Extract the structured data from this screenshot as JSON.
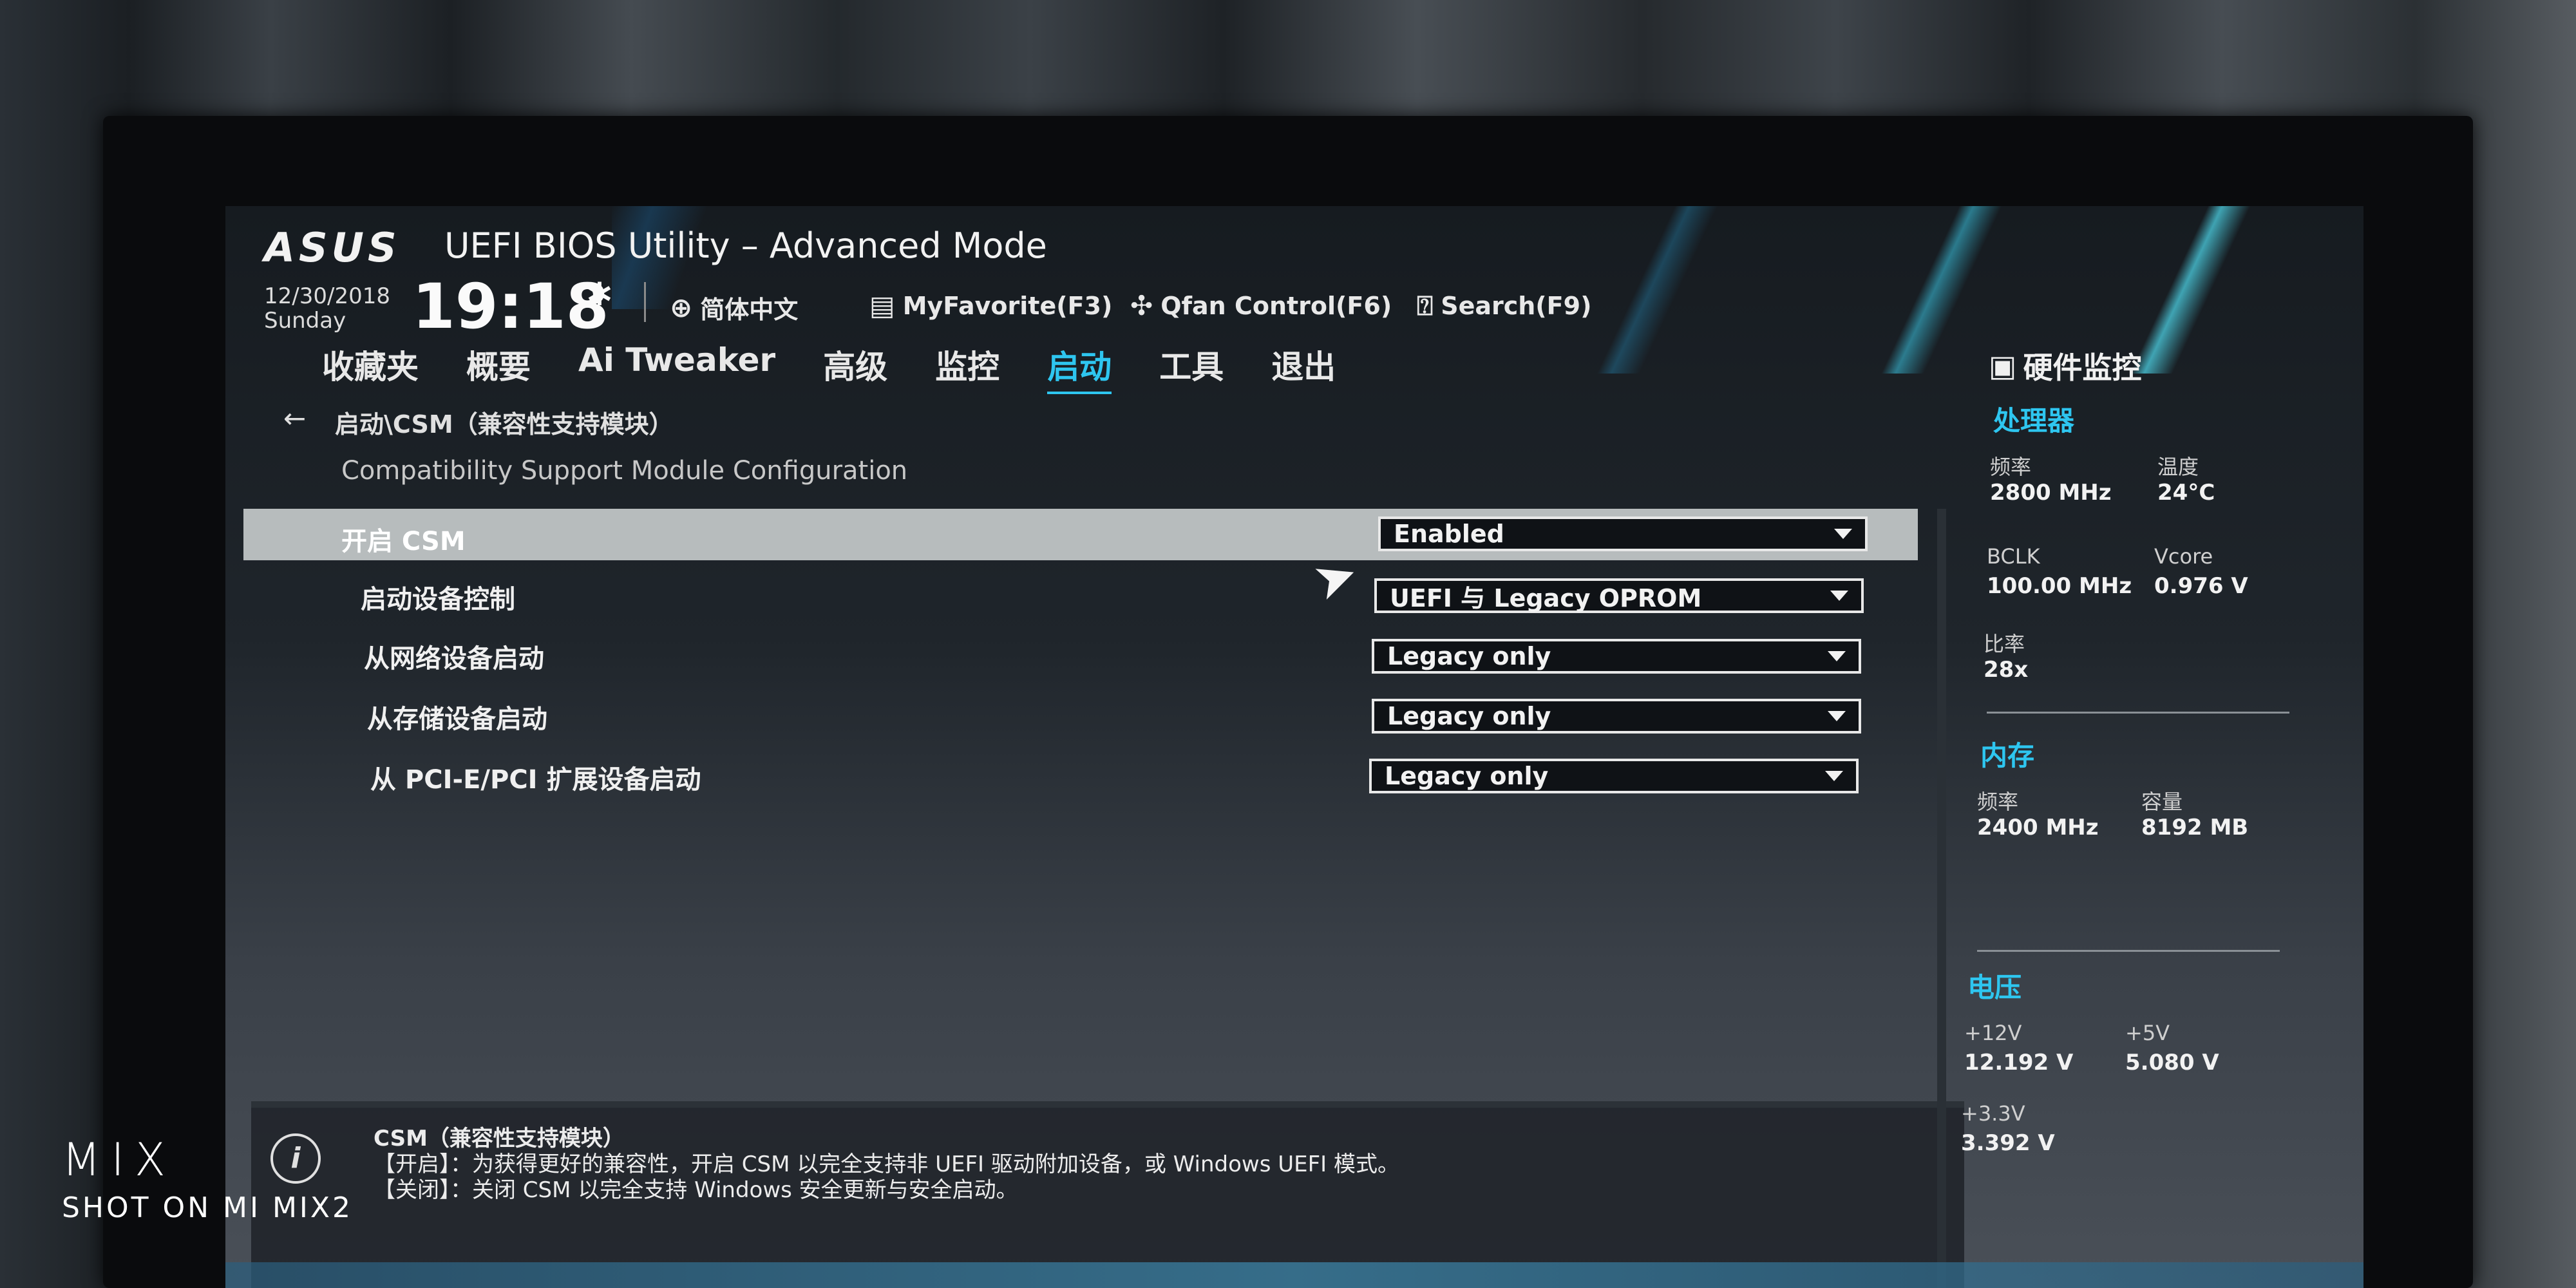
{
  "header": {
    "brand": "ASUS",
    "title": "UEFI BIOS Utility – Advanced Mode",
    "date": "12/30/2018",
    "day": "Sunday",
    "time": "19:18",
    "language": "简体中文",
    "favorite": "MyFavorite(F3)",
    "qfan": "Qfan Control(F6)",
    "search": "Search(F9)"
  },
  "menu": {
    "items": [
      {
        "label": "收藏夹",
        "active": false
      },
      {
        "label": "概要",
        "active": false
      },
      {
        "label": "Ai Tweaker",
        "active": false
      },
      {
        "label": "高级",
        "active": false
      },
      {
        "label": "监控",
        "active": false
      },
      {
        "label": "启动",
        "active": true
      },
      {
        "label": "工具",
        "active": false
      },
      {
        "label": "退出",
        "active": false
      }
    ]
  },
  "breadcrumb": "启动\\CSM（兼容性支持模块）",
  "subtitle": "Compatibility Support Module Configuration",
  "settings": [
    {
      "label": "开启 CSM",
      "value": "Enabled",
      "highlighted": true
    },
    {
      "label": "启动设备控制",
      "value": "UEFI 与 Legacy OPROM",
      "highlighted": false
    },
    {
      "label": "从网络设备启动",
      "value": "Legacy only",
      "highlighted": false
    },
    {
      "label": "从存储设备启动",
      "value": "Legacy only",
      "highlighted": false
    },
    {
      "label": "从 PCI-E/PCI 扩展设备启动",
      "value": "Legacy only",
      "highlighted": false
    }
  ],
  "info": {
    "title": "CSM（兼容性支持模块）",
    "line1": "【开启】：为获得更好的兼容性，开启 CSM 以完全支持非 UEFI 驱动附加设备，或 Windows UEFI 模式。",
    "line2": "【关闭】：关闭 CSM 以完全支持 Windows 安全更新与安全启动。"
  },
  "hw_monitor": {
    "title": "硬件监控",
    "cpu": {
      "title": "处理器",
      "freq_label": "频率",
      "freq": "2800 MHz",
      "temp_label": "温度",
      "temp": "24°C",
      "bclk_label": "BCLK",
      "bclk": "100.00 MHz",
      "vcore_label": "Vcore",
      "vcore": "0.976 V",
      "ratio_label": "比率",
      "ratio": "28x"
    },
    "memory": {
      "title": "内存",
      "freq_label": "频率",
      "freq": "2400 MHz",
      "cap_label": "容量",
      "cap": "8192 MB"
    },
    "voltage": {
      "title": "电压",
      "v12_label": "+12V",
      "v12": "12.192 V",
      "v5_label": "+5V",
      "v5": "5.080 V",
      "v33_label": "+3.3V",
      "v33": "3.392 V"
    }
  },
  "watermark": {
    "line1": "MIX",
    "line2": "SHOT ON MI MIX2"
  },
  "colors": {
    "accent": "#2ec6f0",
    "highlight_row": "#b7bcbd"
  }
}
